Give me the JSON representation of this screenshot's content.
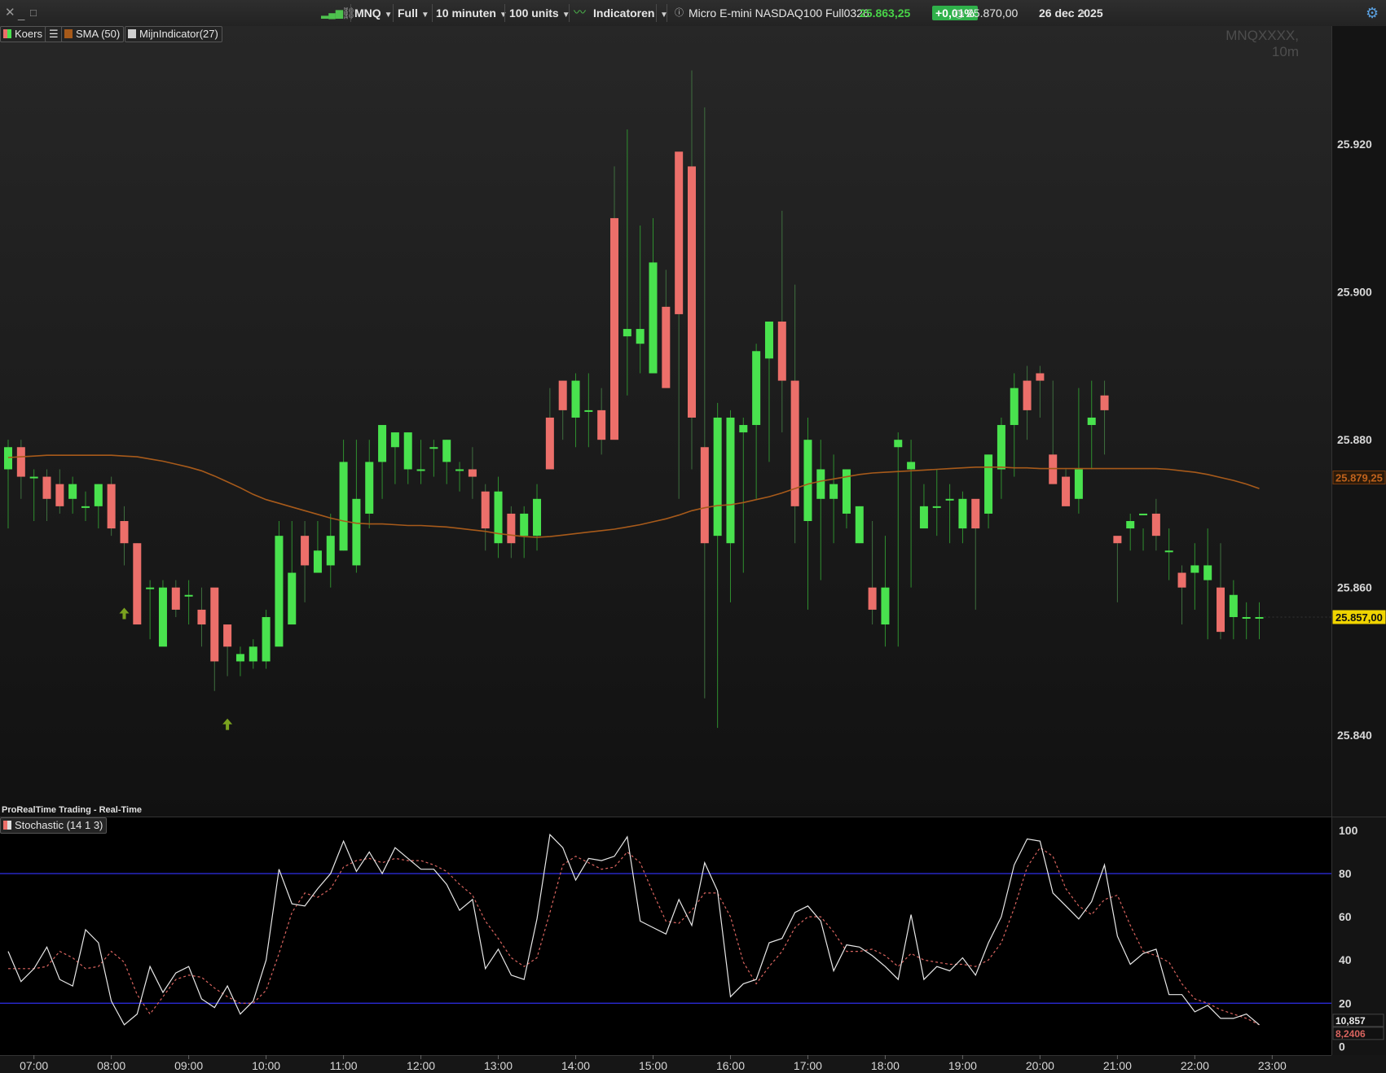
{
  "toolbar": {
    "symbol": "MNQ",
    "mode": "Full",
    "interval": "10 minuten",
    "units": "100 units",
    "indicators_label": "Indicatoren",
    "instrument_name": "Micro E-mini NASDAQ100 Full0326",
    "last_price": "25.863,25",
    "change": "+0,01%",
    "close_price": "25.870,00",
    "date": "26 dec 2025",
    "info_icon": "info-icon",
    "clock_icon": "clock-icon",
    "settings_icon": "gear-icon"
  },
  "legend": {
    "price_label": "Koers",
    "sma_label": "SMA (50)",
    "custom_label": "MijnIndicator(27)",
    "stochastic_label": "Stochastic (14 1 3)"
  },
  "watermark": "MNQXXXX, 10m",
  "vendor_label": "ProRealTime Trading - Real-Time",
  "colors": {
    "background": "#141414",
    "bull": "#49e24e",
    "bear": "#ec6f6a",
    "sma": "#a75a1a",
    "stoch_k": "#e8e8e8",
    "stoch_d": "#d9645f",
    "level_lines": "#2a2ad4",
    "price_tag": "#f0d400",
    "arrow": "#7aa21f"
  },
  "chart_data": [
    {
      "type": "candlestick",
      "x": [
        "06:40",
        "06:50",
        "07:00",
        "07:10",
        "07:20",
        "07:30",
        "07:40",
        "07:50",
        "08:00",
        "08:10",
        "08:20",
        "08:30",
        "08:40",
        "08:50",
        "09:00",
        "09:10",
        "09:20",
        "09:30",
        "09:40",
        "09:50",
        "10:00",
        "10:10",
        "10:20",
        "10:30",
        "10:40",
        "10:50",
        "11:00",
        "11:10",
        "11:20",
        "11:30",
        "11:40",
        "11:50",
        "12:00",
        "12:10",
        "12:20",
        "12:30",
        "12:40",
        "12:50",
        "13:00",
        "13:10",
        "13:20",
        "13:30",
        "13:40",
        "13:50",
        "14:00",
        "14:10",
        "14:20",
        "14:30",
        "14:40",
        "14:50",
        "15:00",
        "15:10",
        "15:20",
        "15:30",
        "15:40",
        "15:50",
        "16:00",
        "16:10",
        "16:20",
        "16:30",
        "16:40",
        "16:50",
        "17:00",
        "17:10",
        "17:20",
        "17:30",
        "17:40",
        "17:50",
        "18:00",
        "18:10",
        "18:20",
        "18:30",
        "18:40",
        "18:50",
        "19:00",
        "19:10",
        "19:20",
        "19:30",
        "19:40",
        "19:50",
        "20:00",
        "20:10",
        "20:20",
        "20:30",
        "20:40",
        "20:50",
        "21:00",
        "21:10",
        "21:20",
        "21:30",
        "21:40",
        "21:50",
        "22:00",
        "22:10",
        "22:20",
        "22:30",
        "22:40",
        "22:50"
      ],
      "open": [
        25876,
        25879,
        25875,
        25875,
        25874,
        25872,
        25871,
        25871,
        25874,
        25869,
        25866,
        25860,
        25852,
        25860,
        25859,
        25857,
        25860,
        25855,
        25850,
        25850,
        25850,
        25852,
        25855,
        25867,
        25862,
        25863,
        25865,
        25863,
        25870,
        25877,
        25879,
        25876,
        25876,
        25879,
        25877,
        25876,
        25876,
        25873,
        25866,
        25870,
        25867,
        25867,
        25883,
        25888,
        25883,
        25884,
        25884,
        25910,
        25894,
        25893,
        25889,
        25898,
        25919,
        25917,
        25879,
        25867,
        25866,
        25881,
        25882,
        25891,
        25896,
        25888,
        25869,
        25872,
        25872,
        25870,
        25866,
        25860,
        25855,
        25879,
        25876,
        25868,
        25871,
        25872,
        25868,
        25872,
        25870,
        25876,
        25882,
        25888,
        25889,
        25878,
        25875,
        25872,
        25882,
        25886,
        25867,
        25868,
        25870,
        25870,
        25865,
        25862,
        25862,
        25861,
        25860,
        25856,
        25856,
        25856
      ],
      "close": [
        25879,
        25875,
        25875,
        25872,
        25871,
        25874,
        25871,
        25874,
        25868,
        25866,
        25855,
        25860,
        25860,
        25857,
        25859,
        25855,
        25850,
        25852,
        25851,
        25852,
        25856,
        25867,
        25862,
        25863,
        25865,
        25867,
        25877,
        25872,
        25877,
        25882,
        25881,
        25881,
        25876,
        25879,
        25880,
        25876,
        25875,
        25868,
        25873,
        25866,
        25870,
        25872,
        25876,
        25884,
        25888,
        25884,
        25880,
        25880,
        25895,
        25895,
        25904,
        25887,
        25897,
        25883,
        25866,
        25883,
        25883,
        25882,
        25892,
        25896,
        25888,
        25871,
        25880,
        25876,
        25874,
        25876,
        25871,
        25857,
        25860,
        25880,
        25877,
        25871,
        25871,
        25872,
        25872,
        25868,
        25878,
        25882,
        25887,
        25884,
        25888,
        25874,
        25871,
        25876,
        25883,
        25884,
        25866,
        25869,
        25870,
        25867,
        25865,
        25860,
        25863,
        25863,
        25854,
        25859,
        25856,
        25856
      ],
      "high": [
        25880,
        25880,
        25876,
        25876,
        25876,
        25875,
        25873,
        25874,
        25875,
        25871,
        25866,
        25861,
        25861,
        25861,
        25861,
        25860,
        25853,
        25853,
        25852,
        25853,
        25857,
        25869,
        25869,
        25869,
        25869,
        25870,
        25880,
        25880,
        25880,
        25880,
        25881,
        25881,
        25880,
        25880,
        25880,
        25877,
        25879,
        25874,
        25875,
        25871,
        25871,
        25874,
        25887,
        25888,
        25889,
        25889,
        25887,
        25917,
        25922,
        25909,
        25910,
        25903,
        25918,
        25930,
        25925,
        25885,
        25884,
        25883,
        25893,
        25893,
        25911,
        25901,
        25883,
        25880,
        25878,
        25876,
        25871,
        25869,
        25867,
        25881,
        25880,
        25874,
        25876,
        25874,
        25873,
        25871,
        25878,
        25883,
        25889,
        25890,
        25890,
        25888,
        25876,
        25887,
        25888,
        25888,
        25866,
        25870,
        25868,
        25872,
        25868,
        25863,
        25866,
        25868,
        25866,
        25861,
        25858,
        25858
      ],
      "low": [
        25868,
        25872,
        25869,
        25869,
        25870,
        25870,
        25869,
        25868,
        25867,
        25863,
        25857,
        25853,
        25856,
        25856,
        25855,
        25852,
        25846,
        25848,
        25848,
        25849,
        25849,
        25853,
        25855,
        25858,
        25863,
        25860,
        25865,
        25862,
        25868,
        25872,
        25874,
        25874,
        25874,
        25875,
        25874,
        25873,
        25872,
        25865,
        25864,
        25864,
        25864,
        25865,
        25876,
        25880,
        25879,
        25879,
        25878,
        25886,
        25886,
        25889,
        25889,
        25895,
        25872,
        25876,
        25845,
        25841,
        25858,
        25862,
        25872,
        25877,
        25881,
        25866,
        25857,
        25861,
        25866,
        25868,
        25866,
        25855,
        25852,
        25852,
        25860,
        25869,
        25867,
        25866,
        25866,
        25857,
        25868,
        25872,
        25875,
        25880,
        25883,
        25874,
        25871,
        25870,
        25876,
        25878,
        25858,
        25865,
        25865,
        25865,
        25861,
        25855,
        25857,
        25853,
        25853,
        25853,
        25853,
        25853
      ],
      "sma": [
        25877.6,
        25877.7,
        25877.8,
        25877.9,
        25877.9,
        25877.9,
        25877.9,
        25877.9,
        25877.9,
        25877.8,
        25877.7,
        25877.4,
        25877.1,
        25876.7,
        25876.3,
        25875.8,
        25875.1,
        25874.3,
        25873.5,
        25872.6,
        25871.9,
        25871.4,
        25870.9,
        25870.4,
        25869.9,
        25869.4,
        25869.0,
        25868.7,
        25868.6,
        25868.6,
        25868.5,
        25868.4,
        25868.4,
        25868.3,
        25868.2,
        25868.0,
        25867.8,
        25867.6,
        25867.3,
        25867.1,
        25866.9,
        25866.8,
        25866.9,
        25867.1,
        25867.3,
        25867.5,
        25867.7,
        25867.9,
        25868.2,
        25868.5,
        25868.9,
        25869.3,
        25869.8,
        25870.4,
        25870.8,
        25871.1,
        25871.2,
        25871.5,
        25871.9,
        25872.3,
        25872.8,
        25873.4,
        25874.0,
        25874.4,
        25874.7,
        25875.0,
        25875.3,
        25875.5,
        25875.6,
        25875.7,
        25875.8,
        25875.9,
        25876.0,
        25876.1,
        25876.2,
        25876.3,
        25876.3,
        25876.3,
        25876.2,
        25876.2,
        25876.1,
        25876.1,
        25876.1,
        25876.1,
        25876.1,
        25876.1,
        25876.1,
        25876.1,
        25876.1,
        25876.1,
        25876.0,
        25875.8,
        25875.6,
        25875.3,
        25874.9,
        25874.5,
        25874.0,
        25873.4
      ],
      "ylim": [
        25829,
        25936
      ],
      "y_ticks": [
        "25.840",
        "25.860",
        "25.880",
        "25.900",
        "25.920"
      ],
      "y_tick_values": [
        25840,
        25860,
        25880,
        25900,
        25920
      ],
      "price_labels": {
        "sma": "25.879,25",
        "last": "25.857,00"
      },
      "signal_arrows_at": [
        "08:10",
        "09:30"
      ]
    },
    {
      "type": "line",
      "title": "Stochastic (14 1 3)",
      "ylim": [
        -4,
        106
      ],
      "y_ticks": [
        "0",
        "20",
        "40",
        "60",
        "80",
        "100"
      ],
      "y_tick_values": [
        0,
        20,
        40,
        60,
        80,
        100
      ],
      "levels": [
        20,
        80
      ],
      "x_ticks": [
        "07:00",
        "08:00",
        "09:00",
        "10:00",
        "11:00",
        "12:00",
        "13:00",
        "14:00",
        "15:00",
        "16:00",
        "17:00",
        "18:00",
        "19:00",
        "20:00",
        "21:00",
        "22:00",
        "23:00"
      ],
      "series": [
        {
          "values": [
            44,
            30,
            36,
            46,
            31,
            28,
            54,
            48,
            21,
            10,
            15,
            37,
            25,
            34,
            37,
            22,
            18,
            28,
            15,
            21,
            40,
            82,
            66,
            65,
            73,
            80,
            95,
            81,
            90,
            80,
            92,
            87,
            82,
            82,
            75,
            63,
            68,
            36,
            45,
            33,
            31,
            59,
            98,
            92,
            77,
            87,
            86,
            88,
            97,
            58,
            55,
            52,
            68,
            56,
            85,
            72,
            23,
            29,
            31,
            48,
            50,
            62,
            65,
            58,
            35,
            47,
            46,
            42,
            37,
            31,
            61,
            31,
            37,
            35,
            41,
            33,
            48,
            60,
            84,
            96,
            95,
            71,
            65,
            59,
            67,
            84,
            51,
            38,
            43,
            45,
            24,
            24,
            16,
            19,
            13,
            13,
            15,
            10
          ]
        },
        {
          "values": [
            36,
            36,
            36,
            37,
            44,
            41,
            36,
            37,
            44,
            39,
            24,
            15,
            23,
            31,
            33,
            32,
            27,
            23,
            20,
            20,
            26,
            43,
            62,
            71,
            69,
            73,
            83,
            86,
            87,
            85,
            87,
            86,
            86,
            84,
            81,
            75,
            70,
            58,
            50,
            41,
            37,
            41,
            62,
            84,
            88,
            85,
            82,
            83,
            90,
            85,
            71,
            58,
            57,
            63,
            71,
            71,
            60,
            39,
            29,
            37,
            44,
            55,
            60,
            60,
            53,
            44,
            44,
            45,
            42,
            37,
            43,
            40,
            39,
            38,
            38,
            37,
            40,
            48,
            64,
            83,
            92,
            88,
            73,
            65,
            61,
            68,
            70,
            56,
            44,
            42,
            39,
            29,
            22,
            20,
            17,
            15,
            13,
            10
          ]
        }
      ],
      "current_values": [
        "10,857",
        "8,2406"
      ]
    }
  ]
}
